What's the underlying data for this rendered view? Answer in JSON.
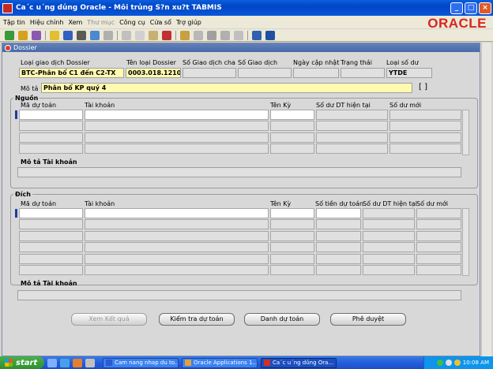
{
  "window": {
    "title": "Ca´c u´ng du̓ng Oracle - Môi tru̓ng S?n xu?t TABMIS"
  },
  "menu": [
    "Tập tin",
    "Hiệu chỉnh",
    "Xem",
    "Thư mục",
    "Công cụ",
    "Cửa sổ",
    "Trợ giúp"
  ],
  "menu_disabled": [
    "Thư mục"
  ],
  "logo": "ORACLE",
  "panel": {
    "title": "Dossier"
  },
  "header": {
    "labels": {
      "type": "Loại giao dịch Dossier",
      "name": "Tên loại Dossier",
      "parent_no": "Số Giao dịch cha",
      "tx_no": "Số Giao dịch",
      "updated": "Ngày cập nhật",
      "status": "Trạng thái",
      "balance_type": "Loại số dư",
      "description": "Mô tả"
    },
    "values": {
      "type": "BTC-Phân bổ C1 đến C2-TX",
      "name": "0003.018.121026.k",
      "parent_no": "",
      "tx_no": "",
      "updated": "",
      "status": "",
      "balance_type": "YTDE",
      "description": "Phân bổ KP quý 4",
      "bracket": "[ ]"
    }
  },
  "source": {
    "title": "Nguồn",
    "columns": {
      "code": "Mã dự toán",
      "account": "Tài khoản",
      "period": "Tên Kỳ",
      "current": "Số dư DT hiện tại",
      "new": "Số dư mới"
    },
    "desc_label": "Mô tả Tài khoản"
  },
  "dest": {
    "title": "Đích",
    "columns": {
      "code": "Mã dự toán",
      "account": "Tài khoản",
      "period": "Tên Kỳ",
      "amount": "Số tiền dự toán",
      "current": "Số dư DT hiện tại",
      "new": "Số dư mới"
    },
    "desc_label": "Mô tả Tài khoản"
  },
  "buttons": {
    "view_result": "Xem Kết quả",
    "check": "Kiểm tra dự toán",
    "list": "Danh dự toán",
    "approve": "Phê duyệt"
  },
  "taskbar": {
    "start": "start",
    "tasks": [
      "Cam nang nhap du to...",
      "Oracle Applications 1...",
      "Ca´c u´ng du̓ng Ora..."
    ],
    "clock": "10:08 AM"
  },
  "colors": {
    "title_bar": "#0a5ddc",
    "oracle_red": "#d8261d",
    "field_yellow": "#fffab0",
    "panel_title": "#5a78b0"
  }
}
